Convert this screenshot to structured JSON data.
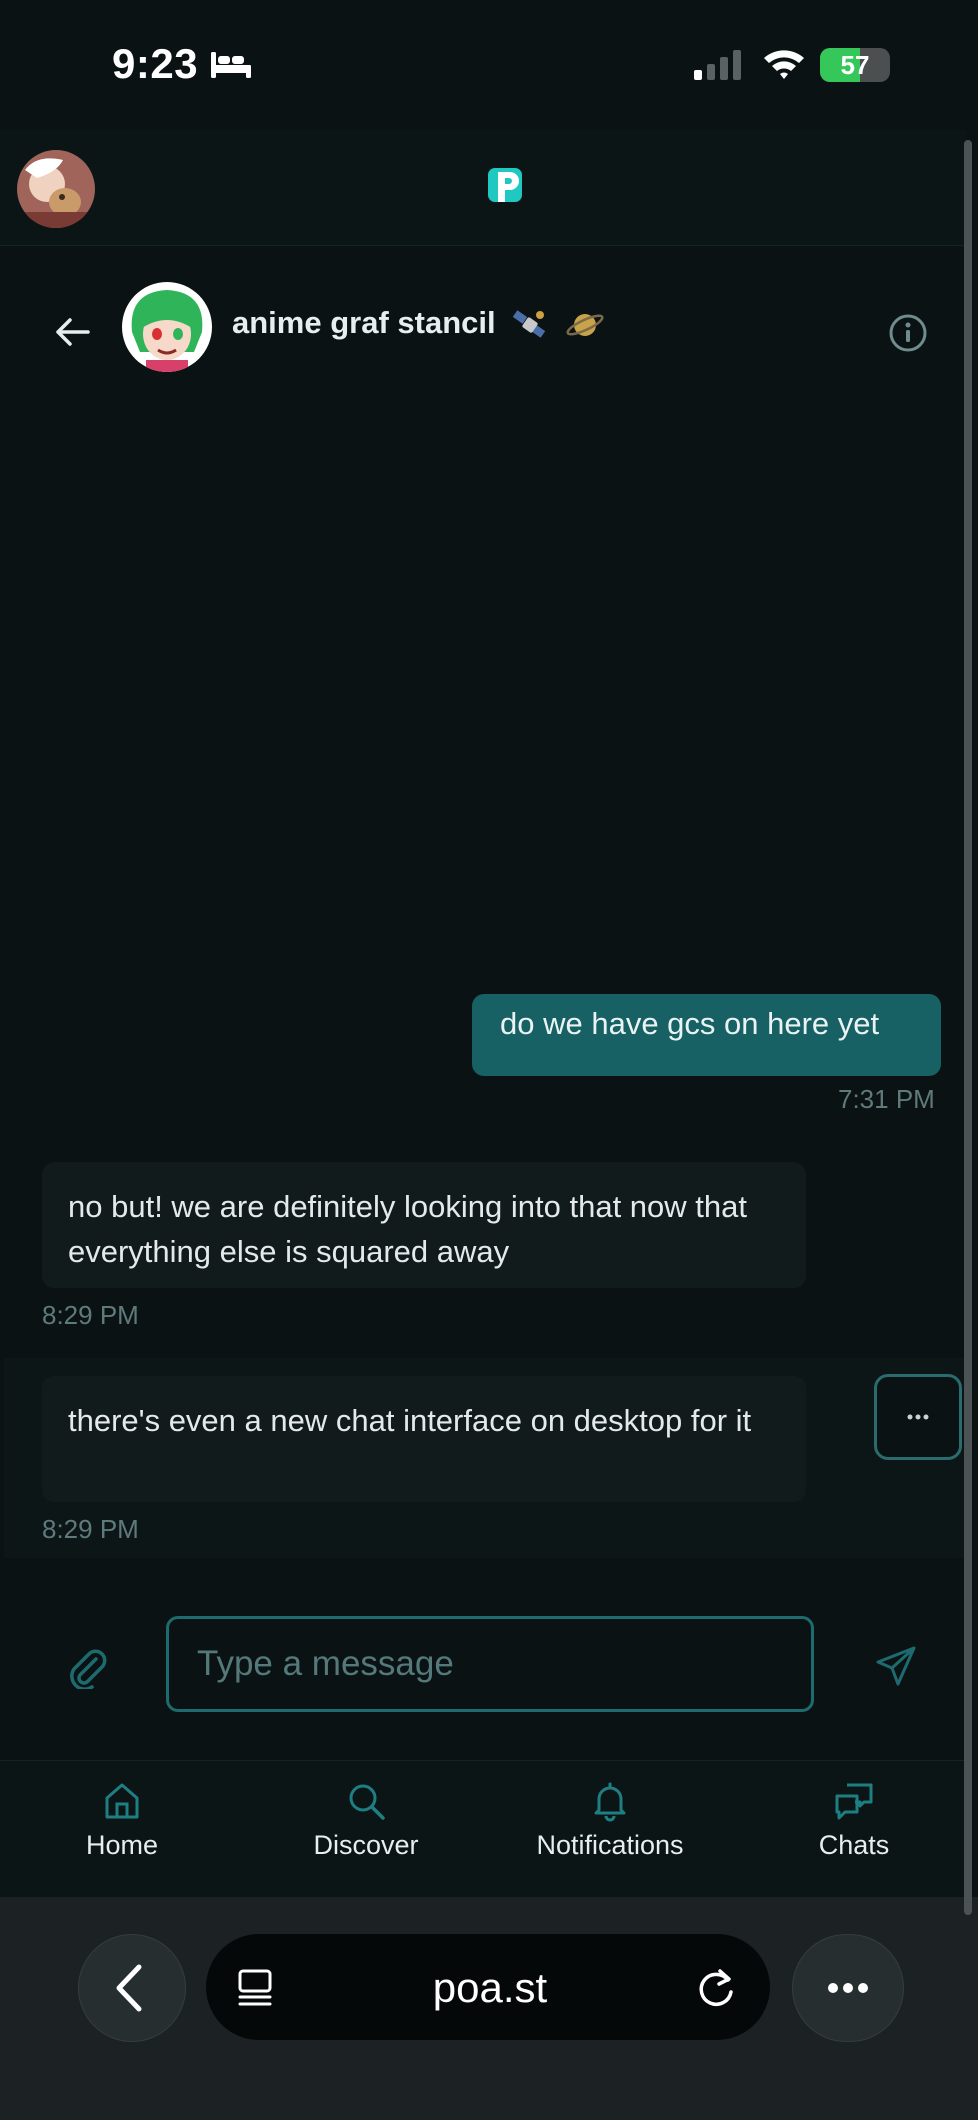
{
  "status_bar": {
    "time": "9:23",
    "battery_percent": "57",
    "battery_level": 0.57,
    "icons": [
      "bed-icon",
      "cellular-signal-icon",
      "wifi-icon",
      "charging-battery-icon"
    ]
  },
  "app_header": {
    "logo_letter": "p",
    "logo_color": "#1fc8c0"
  },
  "chat": {
    "title": "anime graf stancil",
    "title_emojis": [
      "satellite-emoji",
      "ringed-planet-emoji"
    ],
    "messages": [
      {
        "direction": "outgoing",
        "text": "do we have gcs on here yet",
        "time": "7:31 PM"
      },
      {
        "direction": "incoming",
        "text": "no but! we are definitely looking into that now that everything else is squared away",
        "time": "8:29 PM"
      },
      {
        "direction": "incoming",
        "text": "there's even a new chat interface on desktop for it",
        "time": "8:29 PM"
      }
    ],
    "more_label": "···",
    "composer": {
      "placeholder": "Type a message",
      "value": ""
    }
  },
  "bottom_nav": {
    "items": [
      {
        "label": "Home",
        "icon": "home-icon"
      },
      {
        "label": "Discover",
        "icon": "search-icon"
      },
      {
        "label": "Notifications",
        "icon": "bell-icon"
      },
      {
        "label": "Chats",
        "icon": "chat-bubbles-icon"
      }
    ]
  },
  "browser": {
    "url": "poa.st"
  },
  "colors": {
    "background": "#0a1213",
    "outgoing_bubble": "#176064",
    "incoming_bubble": "#111b1c",
    "accent": "#1e6b6f",
    "battery_green": "#35c759"
  }
}
